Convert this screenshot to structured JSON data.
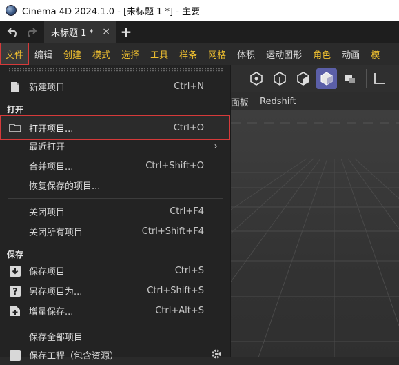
{
  "window": {
    "title": "Cinema 4D 2024.1.0 - [未标题 1 *] - 主要"
  },
  "tabbar": {
    "doc_tab_label": "未标题 1 *",
    "close_glyph": "×",
    "add_glyph": "+"
  },
  "menubar": {
    "items": [
      "文件",
      "编辑",
      "创建",
      "模式",
      "选择",
      "工具",
      "样条",
      "网格",
      "体积",
      "运动图形",
      "角色",
      "动画",
      "模"
    ]
  },
  "viewbar": {
    "items": [
      "面板",
      "Redshift"
    ]
  },
  "file_menu": {
    "new_project": {
      "label": "新建项目",
      "shortcut": "Ctrl+N"
    },
    "open_section": "打开",
    "open_project": {
      "label": "打开项目...",
      "shortcut": "Ctrl+O"
    },
    "recent": {
      "label": "最近打开",
      "arrow": "›"
    },
    "merge": {
      "label": "合并项目...",
      "shortcut": "Ctrl+Shift+O"
    },
    "revert": {
      "label": "恢复保存的项目..."
    },
    "close_project": {
      "label": "关闭项目",
      "shortcut": "Ctrl+F4"
    },
    "close_all": {
      "label": "关闭所有项目",
      "shortcut": "Ctrl+Shift+F4"
    },
    "save_section": "保存",
    "save": {
      "label": "保存项目",
      "shortcut": "Ctrl+S"
    },
    "save_as": {
      "label": "另存项目为...",
      "shortcut": "Ctrl+Shift+S"
    },
    "incremental": {
      "label": "增量保存...",
      "shortcut": "Ctrl+Alt+S"
    },
    "save_all": {
      "label": "保存全部项目"
    },
    "save_with_assets": {
      "label": "保存工程（包含资源）"
    }
  },
  "colors": {
    "accent_gold": "#f0c030",
    "highlight_red": "#d63a3a",
    "selected_tool": "#5b5fa8"
  }
}
